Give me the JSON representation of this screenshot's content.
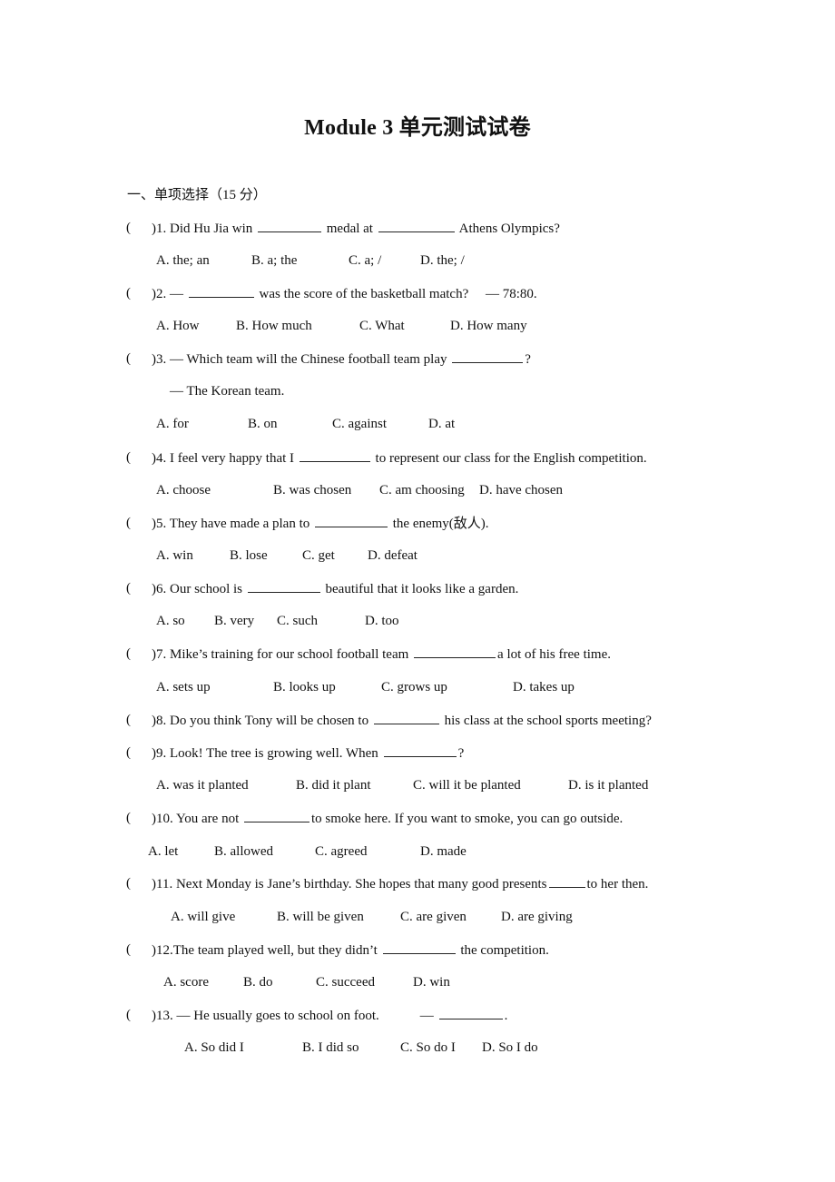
{
  "document": {
    "title": "Module 3 单元测试试卷",
    "section_heading": "一、单项选择（15 分）"
  },
  "questions": [
    {
      "number": "1",
      "paren": "(",
      "parts": [
        "1. Did Hu Jia win ",
        " medal at ",
        " Athens Olympics?"
      ],
      "options": [
        "A. the; an",
        "B. a; the",
        "C. a; /",
        "D. the; /"
      ]
    },
    {
      "number": "2",
      "paren": "(",
      "parts": [
        "2. — ",
        " was the score of the basketball match?     — 78:80."
      ],
      "options": [
        "A. How",
        "B. How much",
        "C. What",
        "D. How many"
      ]
    },
    {
      "number": "3",
      "paren": "(",
      "parts": [
        "3. — Which team will the Chinese football team play ",
        "?"
      ],
      "answer_line": "— The Korean team.",
      "options": [
        "A. for",
        "B. on",
        "C. against",
        "D. at"
      ]
    },
    {
      "number": "4",
      "paren": "(",
      "parts": [
        "4. I feel very happy that I ",
        " to represent our class for the English competition."
      ],
      "options": [
        "A. choose",
        "B. was chosen",
        "C. am choosing",
        "D. have chosen"
      ]
    },
    {
      "number": "5",
      "paren": "(",
      "parts": [
        "5. They have made a plan to ",
        " the enemy(敌人)."
      ],
      "options": [
        "A. win",
        "B. lose",
        "C. get",
        "D. defeat"
      ]
    },
    {
      "number": "6",
      "paren": "(",
      "parts": [
        "6. Our school is ",
        " beautiful that it looks like a garden."
      ],
      "options": [
        "A. so",
        "B. very",
        "C. such",
        "D. too"
      ]
    },
    {
      "number": "7",
      "paren": "(",
      "parts": [
        "7. Mike’s training for our school football team ",
        "a lot of his free time."
      ],
      "options": [
        "A. sets up",
        "B. looks up",
        "C. grows up",
        "D. takes up"
      ]
    },
    {
      "number": "8",
      "paren": "(",
      "parts": [
        "8. Do you think Tony will be chosen to ",
        " his class at the school sports meeting?"
      ],
      "options": []
    },
    {
      "number": "9",
      "paren": "(",
      "parts": [
        "9. Look! The tree is growing well. When ",
        "?"
      ],
      "options": [
        "A. was it planted",
        "B. did it plant",
        "C. will it be planted",
        "D. is it planted"
      ]
    },
    {
      "number": "10",
      "paren": "(",
      "parts": [
        "10. You are not ",
        "to smoke here. If you want to smoke, you can go outside."
      ],
      "options": [
        "A. let",
        "B. allowed",
        "C. agreed",
        "D. made"
      ]
    },
    {
      "number": "11",
      "paren": "(",
      "parts": [
        "11. Next Monday is Jane’s birthday. She hopes that many good presents",
        "to her then."
      ],
      "options": [
        "A. will give",
        "B. will be given",
        "C. are given",
        "D. are giving"
      ]
    },
    {
      "number": "12",
      "paren": "(",
      "parts": [
        "12.The team played well, but they didn’t ",
        " the competition."
      ],
      "options": [
        "A. score",
        "B. do",
        "C. succeed",
        "D. win"
      ]
    },
    {
      "number": "13",
      "paren": "(",
      "parts": [
        "13. — He usually goes to school on foot.            — ",
        "."
      ],
      "options": [
        "A. So did I",
        "B. I did so",
        "C. So do I",
        "D. So I do"
      ]
    }
  ]
}
